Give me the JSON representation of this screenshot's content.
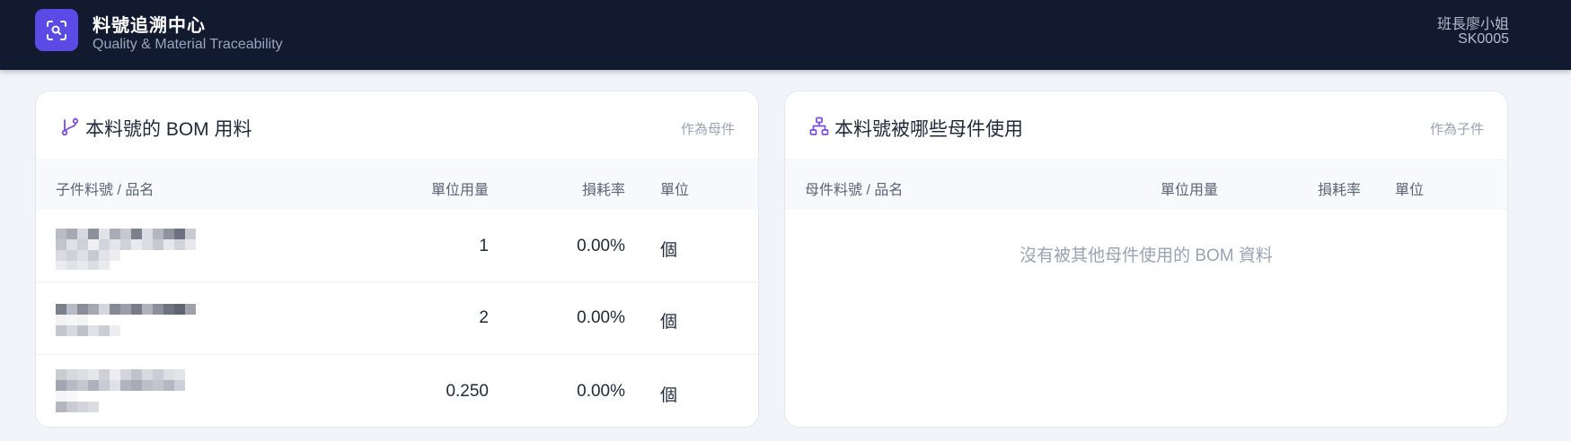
{
  "header": {
    "title": "料號追溯中心",
    "subtitle": "Quality & Material Traceability",
    "user_name": "班長廖小姐",
    "user_id": "SK0005",
    "logo_icon": "scan-search-icon"
  },
  "bom_card": {
    "icon": "git-branch-icon",
    "title": "本料號的 BOM 用料",
    "role": "作為母件",
    "columns": [
      "子件料號 / 品名",
      "單位用量",
      "損耗率",
      "單位"
    ],
    "rows": [
      {
        "qty": "1",
        "loss": "0.00%",
        "unit": "個"
      },
      {
        "qty": "2",
        "loss": "0.00%",
        "unit": "個"
      },
      {
        "qty": "0.250",
        "loss": "0.00%",
        "unit": "個"
      }
    ]
  },
  "where_used_card": {
    "icon": "sitemap-icon",
    "title": "本料號被哪些母件使用",
    "role": "作為子件",
    "columns": [
      "母件料號 / 品名",
      "單位用量",
      "損耗率",
      "單位"
    ],
    "empty_message": "沒有被其他母件使用的 BOM 資料"
  },
  "colors": {
    "topbar": "#111a2e",
    "logo": "#5b4be6",
    "accent_icon": "#7c4ddb"
  }
}
